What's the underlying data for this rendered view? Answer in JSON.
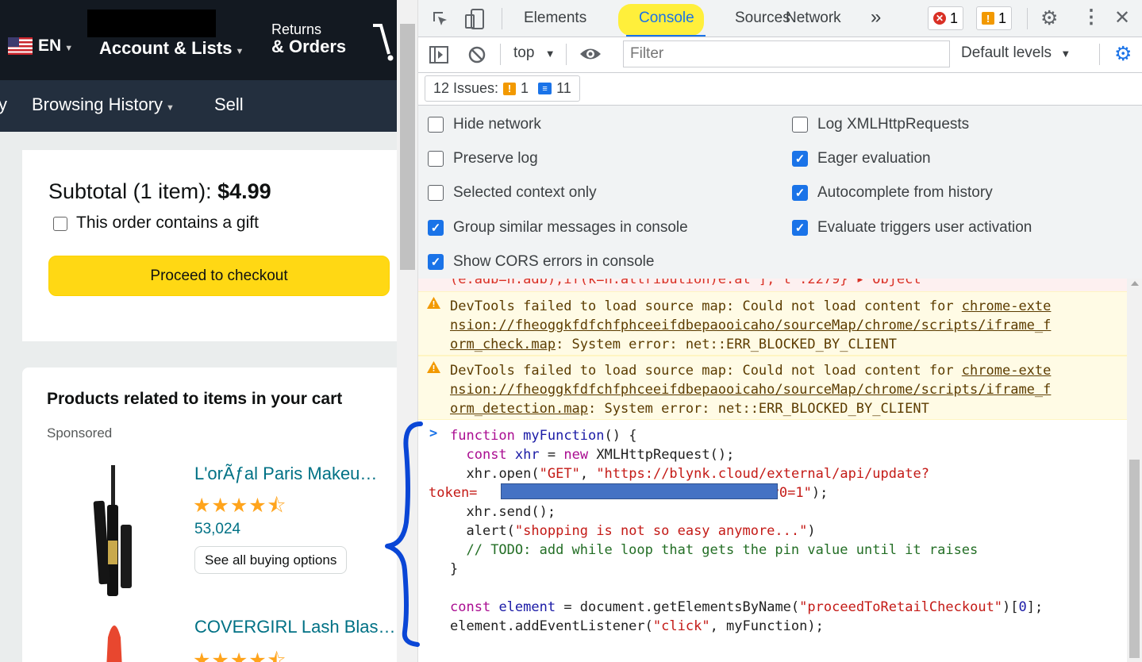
{
  "amazon": {
    "lang": "EN",
    "account": "Account & Lists",
    "returns_line1": "Returns",
    "returns_line2": "& Orders",
    "nav_partial": "y",
    "browsing_history": "Browsing History",
    "sell": "Sell",
    "subtotal_label": "Subtotal (1 item):",
    "subtotal_price": "$4.99",
    "gift_label": "This order contains a gift",
    "checkout_button": "Proceed to checkout",
    "related_title": "Products related to items in your cart",
    "sponsored": "Sponsored",
    "products": [
      {
        "name": "L'orÃƒal Paris Makeu…",
        "rating": 4.5,
        "reviews": "53,024",
        "button": "See all buying options"
      },
      {
        "name": "COVERGIRL Lash Blas…",
        "rating": 4.5
      }
    ]
  },
  "devtools": {
    "tabs": [
      "Elements",
      "Console",
      "Sources",
      "Network"
    ],
    "more_tabs": "»",
    "error_count": "1",
    "warning_count": "1",
    "context": "top",
    "filter_placeholder": "Filter",
    "levels": "Default levels",
    "issues_label": "12 Issues:",
    "issues_warn": "1",
    "issues_info": "11",
    "settings_left": [
      {
        "label": "Hide network",
        "checked": false
      },
      {
        "label": "Preserve log",
        "checked": false
      },
      {
        "label": "Selected context only",
        "checked": false
      },
      {
        "label": "Group similar messages in console",
        "checked": true
      },
      {
        "label": "Show CORS errors in console",
        "checked": true
      }
    ],
    "settings_right": [
      {
        "label": "Log XMLHttpRequests",
        "checked": false
      },
      {
        "label": "Eager evaluation",
        "checked": true
      },
      {
        "label": "Autocomplete from history",
        "checked": true
      },
      {
        "label": "Evaluate triggers user activation",
        "checked": true
      }
    ],
    "error_partial": "(e.adb=n.adb),if(k=n.attribution)e.at ], t :2279} ▸ Object",
    "warnings": [
      {
        "l1a": "DevTools failed to load source map: Could not load content for ",
        "l1b": "chrome-exte",
        "l2": "nsion://fheoggkfdfchfphceeifdbepaooicaho/sourceMap/chrome/scripts/iframe_f",
        "l3a": "orm_check.map",
        "l3b": ": System error: net::ERR_BLOCKED_BY_CLIENT"
      },
      {
        "l1a": "DevTools failed to load source map: Could not load content for ",
        "l1b": "chrome-exte",
        "l2": "nsion://fheoggkfdfchfphceeifdbepaooicaho/sourceMap/chrome/scripts/iframe_f",
        "l3a": "orm_detection.map",
        "l3b": ": System error: net::ERR_BLOCKED_BY_CLIENT"
      }
    ],
    "code": {
      "prompt": ">",
      "c1_kw": "function",
      "c1_fn": "myFunction",
      "c1_rest": "() {",
      "c2_kw": "const",
      "c2_var": "xhr",
      "c2_eq": " = ",
      "c2_new": "new",
      "c2_rest": " XMLHttpRequest();",
      "c3_a": "xhr.",
      "c3_fn": "open",
      "c3_b": "(",
      "c3_s1": "\"GET\"",
      "c3_c": ", ",
      "c3_s2": "\"https://blynk.cloud/external/api/update?",
      "c4_s": "token=",
      "c4_tail": "&v0=1\"",
      "c4_end": ");",
      "c5": "xhr.send();",
      "c6_a": "alert(",
      "c6_s": "\"shopping is not so easy anymore...\"",
      "c6_b": ")",
      "c7": "// TODO: add while loop that gets the pin value until it raises",
      "c8": "}",
      "c9_kw": "const",
      "c9_var": "element",
      "c9_a": " = document.",
      "c9_fn": "getElementsByName",
      "c9_b": "(",
      "c9_s": "\"proceedToRetailCheckout\"",
      "c9_c": ")[",
      "c9_n": "0",
      "c9_d": "];",
      "c10_a": "element.",
      "c10_fn": "addEventListener",
      "c10_b": "(",
      "c10_s": "\"click\"",
      "c10_c": ", myFunction);"
    }
  },
  "colors": {
    "annotation_highlight": "#ffef3b",
    "annotation_brace": "#0a46d6",
    "redaction_blue": "#4472c4"
  }
}
